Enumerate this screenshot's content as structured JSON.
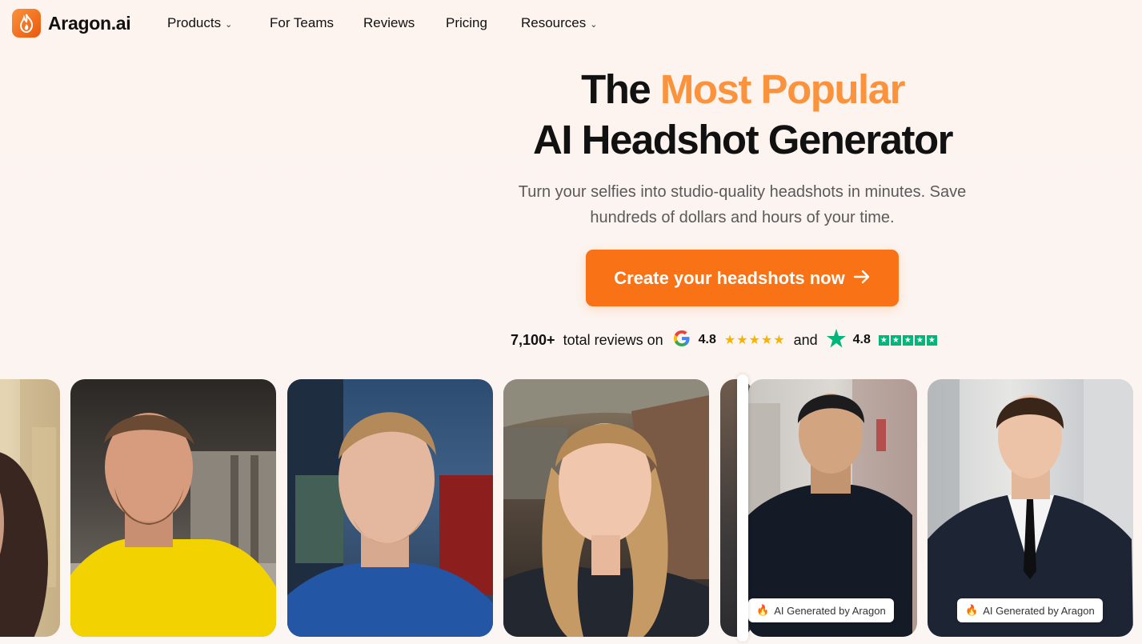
{
  "brand": {
    "name": "Aragon.ai"
  },
  "nav": {
    "items": [
      {
        "label": "Products",
        "dropdown": true
      },
      {
        "label": "For Teams",
        "dropdown": false
      },
      {
        "label": "Reviews",
        "dropdown": false
      },
      {
        "label": "Pricing",
        "dropdown": false
      },
      {
        "label": "Resources",
        "dropdown": true
      }
    ]
  },
  "hero": {
    "title_prefix": "The ",
    "title_accent": "Most Popular",
    "title_line2": "AI Headshot Generator",
    "subtitle": "Turn your selfies into studio-quality headshots in minutes. Save hundreds of dollars and hours of your time.",
    "cta_label": "Create your headshots now",
    "accent_color": "#fb923c",
    "cta_color": "#f97316"
  },
  "reviews": {
    "count": "7,100+",
    "text": "total reviews on",
    "google_rating": "4.8",
    "and": "and",
    "trustpilot_rating": "4.8",
    "icons": [
      "google-g-icon",
      "trustpilot-star-icon"
    ]
  },
  "gallery": {
    "badge_label": "AI Generated by Aragon"
  }
}
